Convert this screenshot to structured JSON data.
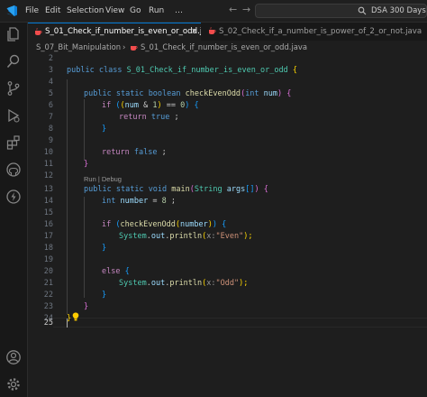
{
  "window": {
    "menu": [
      "File",
      "Edit",
      "Selection",
      "View",
      "Go",
      "Run",
      "…"
    ],
    "search_text": "DSA 300 Days"
  },
  "tabs": [
    {
      "label": "S_01_Check_if_number_is_even_or_odd.java",
      "active": true,
      "close": "×"
    },
    {
      "label": "S_02_Check_if_a_number_is_power_of_2_or_not.java",
      "active": false
    }
  ],
  "breadcrumb": {
    "folder": "S_07_Bit_Manipulation",
    "separator": "›",
    "file": "S_01_Check_if_number_is_even_or_odd.java"
  },
  "editor": {
    "line_numbers": [
      "2",
      "3",
      "4",
      "5",
      "6",
      "7",
      "8",
      "9",
      "10",
      "11",
      "12",
      "13",
      "14",
      "15",
      "16",
      "17",
      "18",
      "19",
      "20",
      "21",
      "22",
      "23",
      "24",
      "25"
    ],
    "current_line": "25",
    "codelens": "Run | Debug",
    "lines": {
      "l3": {
        "t1": "public",
        "t2": "class",
        "t3": "S_01_Check_if_number_is_even_or_odd",
        "t4": "{"
      },
      "l5": {
        "t1": "public",
        "t2": "static",
        "t3": "boolean",
        "t4": "checkEvenOdd",
        "t5": "(",
        "t6": "int",
        "t7": "num",
        "t8": ")",
        "t9": "{"
      },
      "l6": {
        "t1": "if",
        "t2": "(",
        "t3": "(",
        "t4": "num",
        "t5": "&",
        "t6": "1",
        "t7": ")",
        "t8": "==",
        "t9": "0",
        "t10": ")",
        "t11": "{"
      },
      "l7": {
        "t1": "return",
        "t2": "true",
        "t3": ";"
      },
      "l8": {
        "t1": "}"
      },
      "l10": {
        "t1": "return",
        "t2": "false",
        "t3": ";"
      },
      "l11": {
        "t1": "}"
      },
      "l13": {
        "t1": "public",
        "t2": "static",
        "t3": "void",
        "t4": "main",
        "t5": "(",
        "t6": "String",
        "t7": "args",
        "t8": "[]",
        "t9": ")",
        "t10": "{"
      },
      "l14": {
        "t1": "int",
        "t2": "number",
        "t3": "=",
        "t4": "8",
        "t5": ";"
      },
      "l16": {
        "t1": "if",
        "t2": "(",
        "t3": "checkEvenOdd",
        "t4": "(",
        "t5": "number",
        "t6": ")",
        "t7": ")",
        "t8": "{"
      },
      "l17": {
        "t1": "System",
        "t2": ".",
        "t3": "out",
        "t4": ".",
        "t5": "println",
        "t6": "(",
        "t7": "x:",
        "t8": "\"Even\"",
        "t9": ");"
      },
      "l18": {
        "t1": "}"
      },
      "l20": {
        "t1": "else",
        "t2": "{"
      },
      "l21": {
        "t1": "System",
        "t2": ".",
        "t3": "out",
        "t4": ".",
        "t5": "println",
        "t6": "(",
        "t7": "x:",
        "t8": "\"Odd\"",
        "t9": ");"
      },
      "l22": {
        "t1": "}"
      },
      "l23": {
        "t1": "}"
      },
      "l24": {
        "t1": "}"
      }
    }
  },
  "colors": {
    "keyword": "#569cd6",
    "control": "#c586c0",
    "class": "#4ec9b0",
    "function": "#dcdcaa",
    "variable": "#9cdcfe",
    "number": "#b5cea8",
    "string": "#ce9178",
    "accent": "#0078d4",
    "java_icon": "#f14c4c"
  },
  "icons": {
    "activity_bar": [
      "explorer-icon",
      "search-icon",
      "source-control-icon",
      "run-debug-icon",
      "extensions-icon",
      "github-icon",
      "thunder-icon",
      "account-icon",
      "settings-gear-icon"
    ],
    "titlebar": [
      "vscode-logo-icon",
      "back-arrow-icon",
      "forward-arrow-icon",
      "search-icon"
    ],
    "editor": [
      "lightbulb-icon"
    ]
  }
}
